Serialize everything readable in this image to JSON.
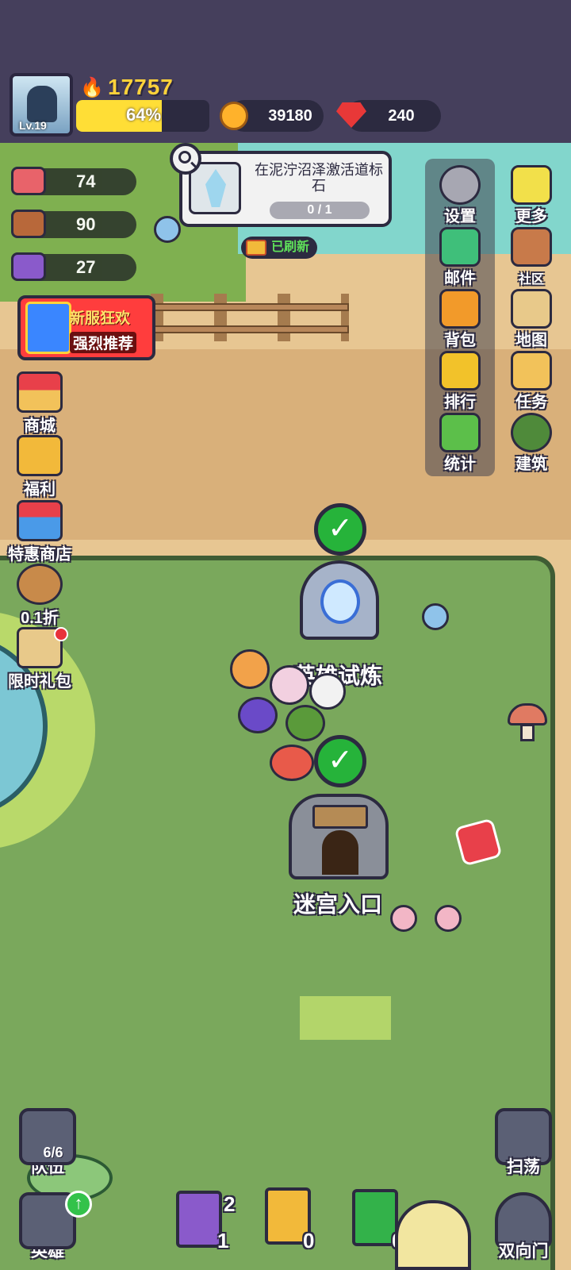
{
  "player": {
    "level": "Lv.19",
    "power": "17757",
    "xp_text": "64%",
    "xp_fraction": 0.64
  },
  "currency": {
    "coins": "39180",
    "gems": "240"
  },
  "resources": [
    {
      "name": "meat-icon",
      "value": "74"
    },
    {
      "name": "wood-icon",
      "value": "90"
    },
    {
      "name": "ore-icon",
      "value": "27"
    }
  ],
  "quest": {
    "title": "在泥泞沼泽激活道标石",
    "progress": "0 / 1",
    "refresh_label": "已刷新"
  },
  "promo": {
    "line1": "新服狂欢",
    "line2": "强烈推荐"
  },
  "left_menu": [
    "商城",
    "福利",
    "特惠商店",
    "0.1折",
    "限时礼包"
  ],
  "right_menu": {
    "col1": [
      "设置",
      "邮件",
      "背包",
      "排行",
      "统计"
    ],
    "col2": [
      "更多",
      "社区",
      "地图",
      "任务",
      "建筑"
    ]
  },
  "map": {
    "hero_trial": "英雄试炼",
    "maze_entrance": "迷宫入口"
  },
  "bottom": {
    "team_label": "队伍",
    "team_count": "6/6",
    "hero_label": "英雄",
    "sweep_label": "扫荡",
    "door_label": "双向门",
    "book_counts": [
      "2",
      "1",
      "0",
      "0"
    ]
  },
  "colors": {
    "background": "#453f5c",
    "xp_fill": "#ffde36",
    "grass": "#7aa85c",
    "check": "#26b33a"
  }
}
